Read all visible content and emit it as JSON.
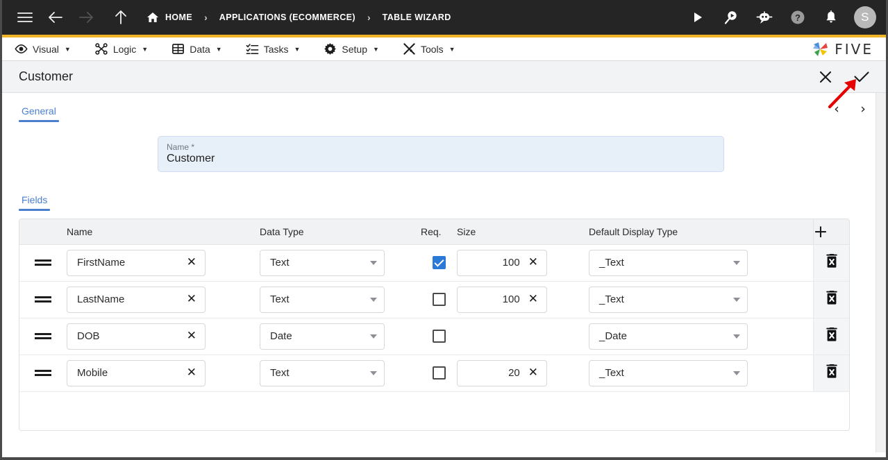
{
  "topbar": {
    "menu_icon": "hamburger-icon",
    "back_icon": "arrow-left-icon",
    "forward_icon": "arrow-right-icon",
    "up_icon": "arrow-up-icon",
    "home_icon": "home-icon",
    "breadcrumbs": [
      {
        "label": "HOME",
        "icon": "home-icon"
      },
      {
        "label": "APPLICATIONS (ECOMMERCE)"
      },
      {
        "label": "TABLE WIZARD"
      }
    ],
    "separator": "›",
    "actions": [
      {
        "name": "run-icon",
        "glyph": "▶"
      },
      {
        "name": "search-play-icon",
        "glyph": "⌕"
      },
      {
        "name": "chatbot-icon",
        "glyph": "●"
      },
      {
        "name": "help-icon",
        "glyph": "?"
      },
      {
        "name": "notifications-bell-icon",
        "glyph": "ὑ4"
      }
    ],
    "avatar_initial": "S"
  },
  "menubar": {
    "items": [
      {
        "label": "Visual",
        "icon": "eye-icon"
      },
      {
        "label": "Logic",
        "icon": "flow-icon"
      },
      {
        "label": "Data",
        "icon": "table-icon"
      },
      {
        "label": "Tasks",
        "icon": "checklist-icon"
      },
      {
        "label": "Setup",
        "icon": "gear-icon"
      },
      {
        "label": "Tools",
        "icon": "tools-icon"
      }
    ],
    "caret": "▼",
    "brand": "FIVE"
  },
  "titlebar": {
    "title": "Customer",
    "close_label": "✕",
    "confirm_label": "✓"
  },
  "general": {
    "tab_label": "General",
    "prev_label": "‹",
    "next_label": "›",
    "name_field": {
      "label": "Name *",
      "value": "Customer",
      "placeholder": "Name"
    }
  },
  "fields_section": {
    "tab_label": "Fields",
    "add_row_label": "+",
    "columns": [
      "",
      "Name",
      "Data Type",
      "Req.",
      "Size",
      "Default Display Type",
      ""
    ],
    "rows": [
      {
        "name": "FirstName",
        "data_type": "Text",
        "required": true,
        "size": "100",
        "default_display_type": "_Text",
        "clear_label": "✕",
        "delete_icon": "trash-delete-icon"
      },
      {
        "name": "LastName",
        "data_type": "Text",
        "required": false,
        "size": "100",
        "default_display_type": "_Text",
        "clear_label": "✕",
        "delete_icon": "trash-delete-icon"
      },
      {
        "name": "DOB",
        "data_type": "Date",
        "required": false,
        "size": "",
        "default_display_type": "_Date",
        "clear_label": "✕",
        "delete_icon": "trash-delete-icon"
      },
      {
        "name": "Mobile",
        "data_type": "Text",
        "required": false,
        "size": "20",
        "default_display_type": "_Text",
        "clear_label": "✕",
        "delete_icon": "trash-delete-icon"
      }
    ]
  },
  "colors": {
    "topbar_bg": "#252525",
    "accent_strip": "#f0b429",
    "tab_accent": "#4a7fd0",
    "checkbox_checked": "#2a79d6",
    "name_field_bg": "#e7f0f9",
    "annotation_arrow": "#e60000"
  }
}
